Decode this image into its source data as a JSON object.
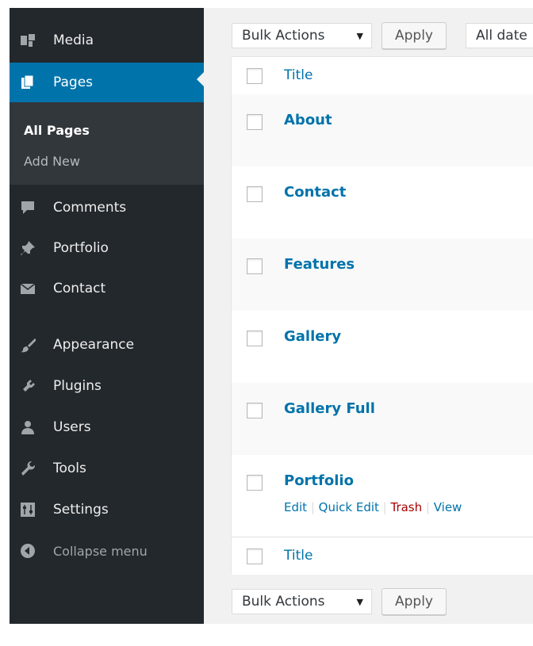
{
  "sidebar": {
    "items": [
      {
        "id": "media",
        "label": "Media",
        "icon": "media-icon"
      },
      {
        "id": "pages",
        "label": "Pages",
        "icon": "pages-icon",
        "current": true
      },
      {
        "id": "comments",
        "label": "Comments",
        "icon": "comments-icon"
      },
      {
        "id": "portfolio",
        "label": "Portfolio",
        "icon": "pin-icon"
      },
      {
        "id": "contact",
        "label": "Contact",
        "icon": "envelope-icon"
      },
      {
        "id": "appearance",
        "label": "Appearance",
        "icon": "brush-icon"
      },
      {
        "id": "plugins",
        "label": "Plugins",
        "icon": "plug-icon"
      },
      {
        "id": "users",
        "label": "Users",
        "icon": "users-icon"
      },
      {
        "id": "tools",
        "label": "Tools",
        "icon": "wrench-icon"
      },
      {
        "id": "settings",
        "label": "Settings",
        "icon": "sliders-icon"
      }
    ],
    "submenu": {
      "all_pages": "All Pages",
      "add_new": "Add New"
    },
    "collapse_label": "Collapse menu"
  },
  "toolbar": {
    "bulk_actions": "Bulk Actions",
    "apply": "Apply",
    "all_dates": "All date"
  },
  "table": {
    "column_title": "Title",
    "rows": [
      {
        "title": "About"
      },
      {
        "title": "Contact"
      },
      {
        "title": "Features"
      },
      {
        "title": "Gallery"
      },
      {
        "title": "Gallery Full"
      },
      {
        "title": "Portfolio",
        "actions": {
          "edit": "Edit",
          "quick_edit": "Quick Edit",
          "trash": "Trash",
          "view": "View"
        }
      }
    ]
  },
  "colors": {
    "sidebar_bg": "#23282d",
    "accent": "#0073aa",
    "trash": "#a00000"
  }
}
